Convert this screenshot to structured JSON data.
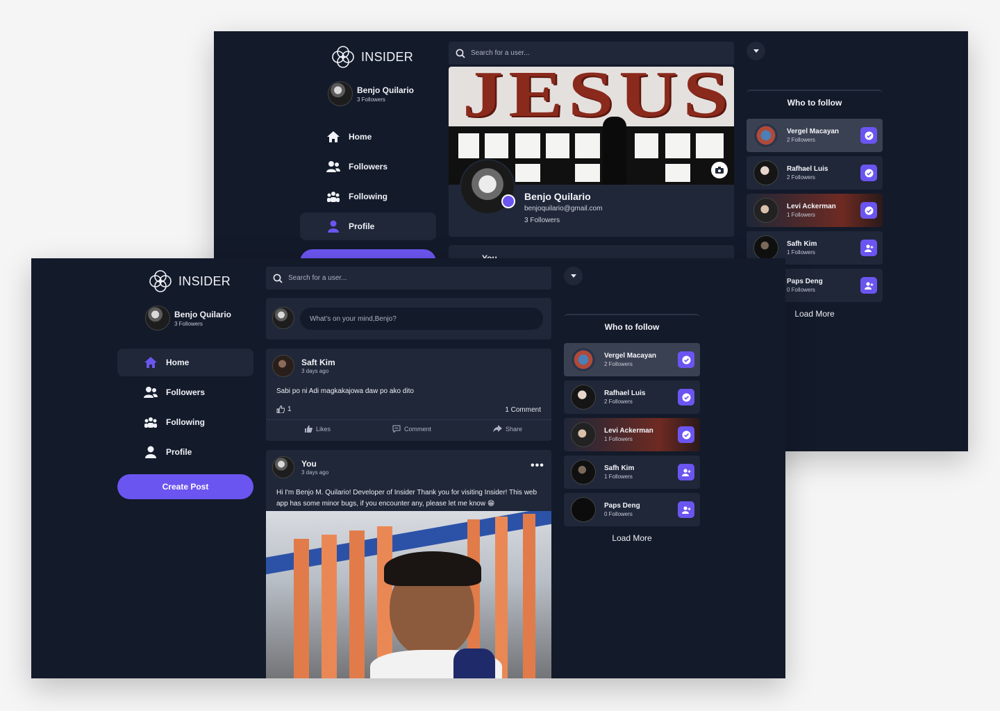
{
  "app": {
    "name": "INSIDER"
  },
  "user": {
    "name": "Benjo Quilario",
    "followers": "3 Followers",
    "email": "benjoquilario@gmail.com"
  },
  "nav": [
    {
      "label": "Home",
      "icon": "home-icon"
    },
    {
      "label": "Followers",
      "icon": "followers-icon"
    },
    {
      "label": "Following",
      "icon": "following-icon"
    },
    {
      "label": "Profile",
      "icon": "profile-icon"
    }
  ],
  "create_post_label": "Create Post",
  "search": {
    "placeholder": "Search for a user..."
  },
  "back_screen": {
    "cover_text": "JESUS",
    "peek_label": "You"
  },
  "composer": {
    "placeholder": "What's on your mind,Benjo?"
  },
  "posts": [
    {
      "author": "Saft Kim",
      "time": "3 days ago",
      "text": "Sabi po ni Adi magkakajowa daw po ako dito",
      "likes_count": "1",
      "comments_count": "1 Comment",
      "actions": [
        "Likes",
        "Comment",
        "Share"
      ]
    },
    {
      "author": "You",
      "time": "3 days ago",
      "text": "Hi I'm Benjo M. Quilario! Developer of Insider  Thank you for visiting Insider! This web app has some minor bugs, if you encounter any, please let me know 😁"
    }
  ],
  "who_to_follow": {
    "title": "Who to follow",
    "items": [
      {
        "name": "Vergel Macayan",
        "followers": "2 Followers",
        "following": true
      },
      {
        "name": "Rafhael Luis",
        "followers": "2 Followers",
        "following": true
      },
      {
        "name": "Levi Ackerman",
        "followers": "1 Followers",
        "following": true
      },
      {
        "name": "Safh Kim",
        "followers": "1 Followers",
        "following": false
      },
      {
        "name": "Paps Deng",
        "followers": "0 Followers",
        "following": false
      }
    ],
    "load_more": "Load More"
  },
  "colors": {
    "background": "#131a2a",
    "card": "#1f2738",
    "accent": "#6b55f0",
    "page": "#f5f5f6"
  }
}
